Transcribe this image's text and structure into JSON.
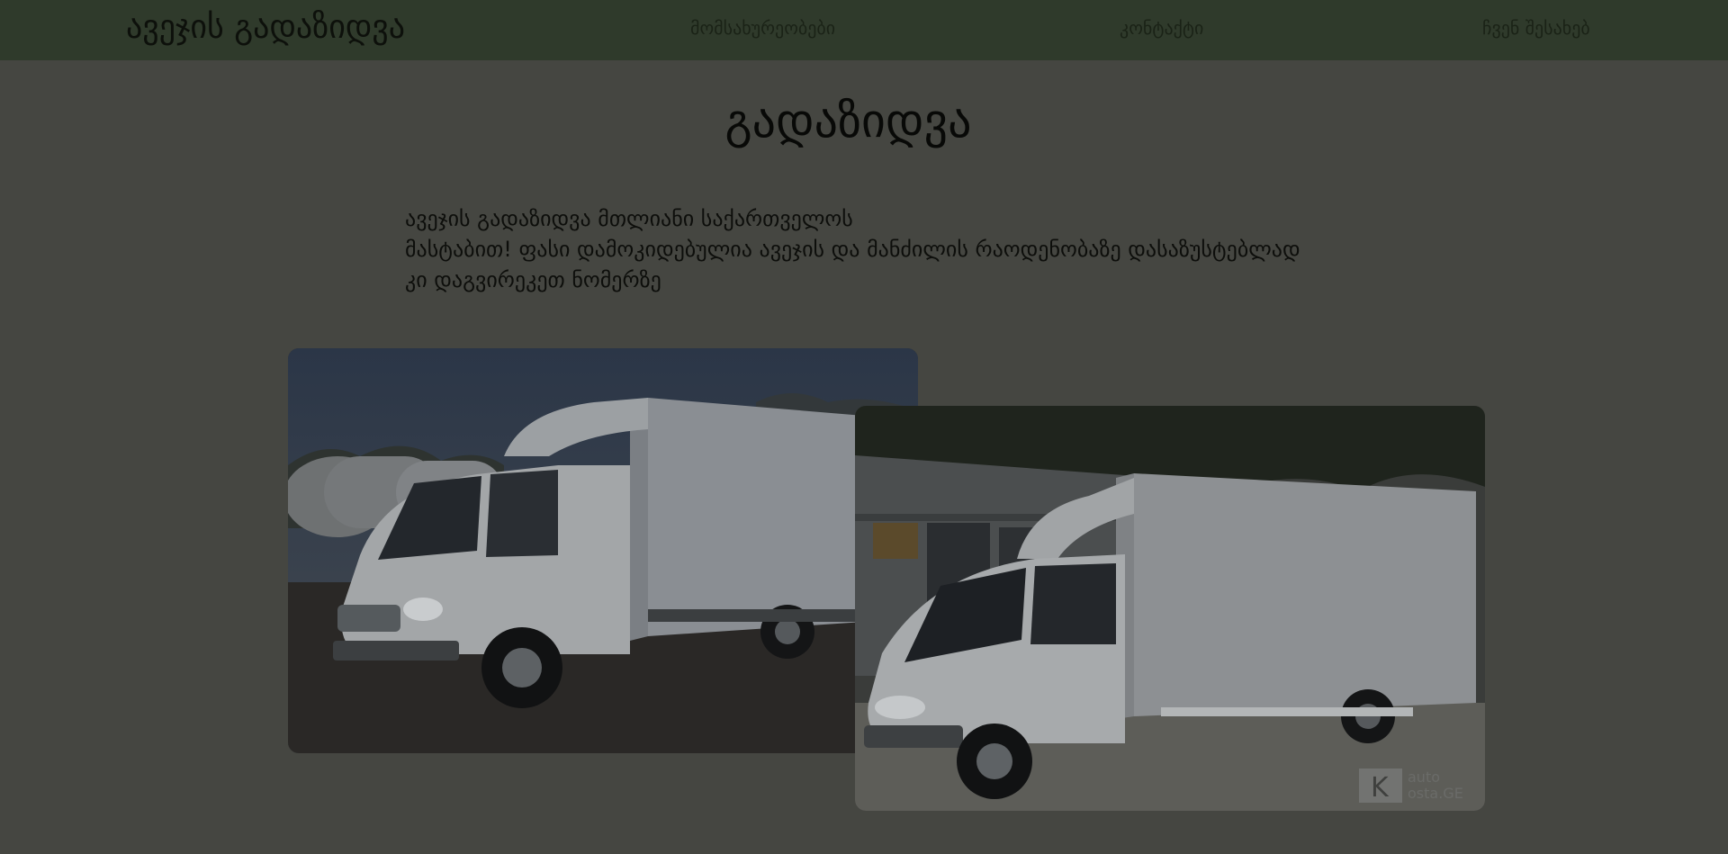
{
  "header": {
    "brand": "ავეჯის გადაზიდვა",
    "nav": {
      "services": "მომსახურეობები",
      "contact": "კონტაქტი",
      "about": "ჩვენ შესახებ"
    }
  },
  "main": {
    "title": "გადაზიდვა",
    "description_lines": [
      "ავეჯის გადაზიდვა მთლიანი საქართველოს",
      "მასტაბით! ფასი დამოკიდებულია ავეჯის და მანძილის რაოდენობაზე დასაზუსტებლად",
      "კი დაგვირეკეთ ნომერზე"
    ]
  },
  "gallery": {
    "watermark": {
      "letter": "K",
      "line1": "auto",
      "line2": "osta.GE"
    }
  },
  "colors": {
    "nav_background": "#2f3a2b",
    "page_background": "#454641"
  }
}
